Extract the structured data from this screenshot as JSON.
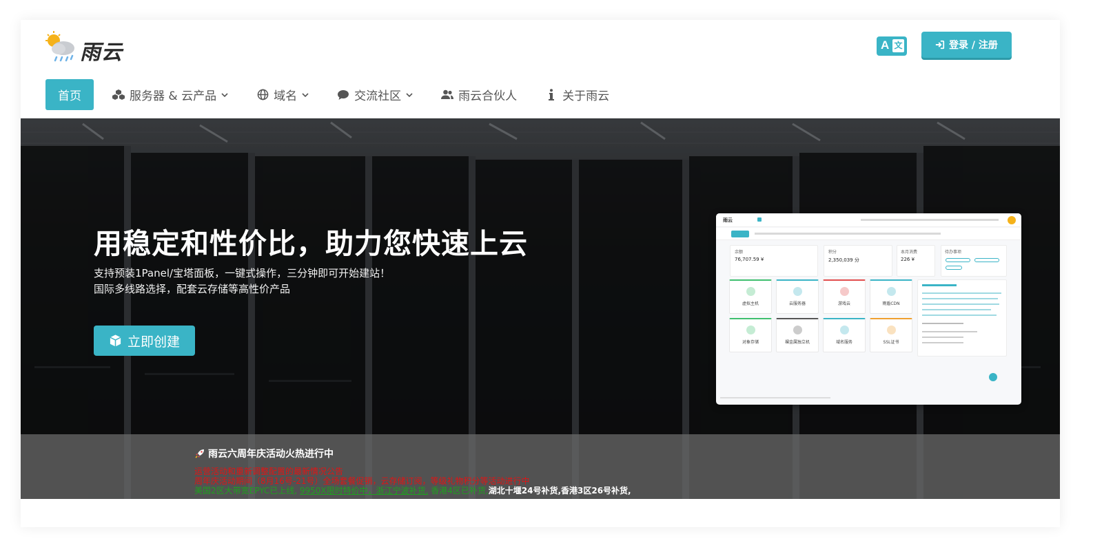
{
  "brand": {
    "name": "雨云"
  },
  "header": {
    "login_label": "登录 / 注册"
  },
  "nav": {
    "items": [
      {
        "label": "首页",
        "icon": "none",
        "active": true
      },
      {
        "label": "服务器 & 云产品",
        "icon": "cubes-icon",
        "dropdown": true
      },
      {
        "label": "域名",
        "icon": "globe-icon",
        "dropdown": true
      },
      {
        "label": "交流社区",
        "icon": "comment-icon",
        "dropdown": true
      },
      {
        "label": "雨云合伙人",
        "icon": "users-icon"
      },
      {
        "label": "关于雨云",
        "icon": "info-icon"
      }
    ]
  },
  "hero": {
    "title": "用稳定和性价比，助力您快速上云",
    "sub_line1": "支持预装1Panel/宝塔面板，一键式操作，三分钟即可开始建站！",
    "sub_line2": "国际多线路选择，配套云存储等高性价产品",
    "cta_label": "立即创建"
  },
  "preview": {
    "stats": [
      {
        "label": "余额",
        "value": "76,707.59 ¥"
      },
      {
        "label": "积分",
        "value": "2,350,039 分"
      },
      {
        "label": "本月消费",
        "value": "226 ¥"
      },
      {
        "label": "待办事项",
        "value": ""
      }
    ],
    "tiles": [
      {
        "label": "虚拟主机",
        "color": "#3fbf6f"
      },
      {
        "label": "云服务器",
        "color": "#3ab4c6"
      },
      {
        "label": "游戏云",
        "color": "#e24d4d"
      },
      {
        "label": "雨盾CDN",
        "color": "#3ab4c6"
      },
      {
        "label": "对象存储",
        "color": "#3fbf6f"
      },
      {
        "label": "裸金属独立机",
        "color": "#555555"
      },
      {
        "label": "域名服务",
        "color": "#3ab4c6"
      },
      {
        "label": "SSL证书",
        "color": "#f0a030"
      }
    ]
  },
  "announce": {
    "title": "雨云六周年庆活动火热进行中",
    "line1": "运营活动和重新调整配置的最新情况公告",
    "line2": "周年庆活动期间（8月16号-21号）全场套餐促销，云存储订阅，等级礼物积分等活动进行中",
    "line3_a": "美国2区大带宽EPYC已上线,",
    "line3_b": "9950X限时特价中，浙江宁波补货,",
    "line3_c": "香港4区已补货,",
    "line3_d": "湖北十堰24号补货,香港3区26号补货,"
  },
  "colors": {
    "accent": "#3ab4c6",
    "hero_bg": "#1e2022",
    "announce_red": "#e01515",
    "announce_green": "#1fa01f"
  }
}
